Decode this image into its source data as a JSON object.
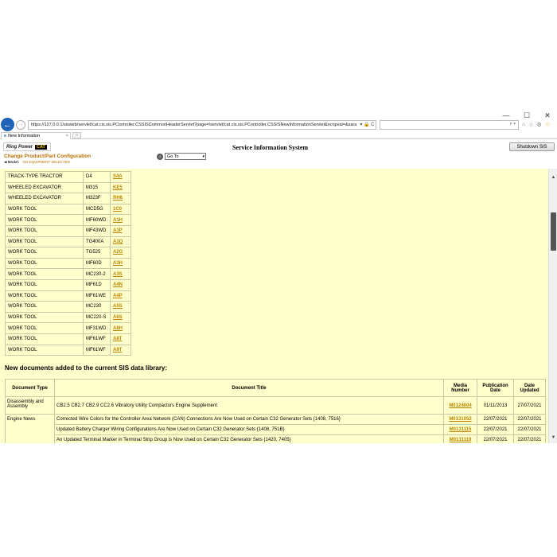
{
  "browser": {
    "window_controls": [
      "—",
      "☐",
      "✕"
    ],
    "url": "https://127.0.0.1/sisweb/servlet/cat.cis.sis.PController.CSSISCommonHeaderServlet?page=/servlet/cat.cis.sis.PController.CSSISNewInformationServlet&ncnpval=&sara",
    "url_security": "▾ 🔒 C",
    "search_text": "⌕ ▾",
    "tab_title": "New Information",
    "tab_icon": "e",
    "tab_close": "×",
    "toolbar_icons": [
      "⌂",
      "☆",
      "⚙",
      "☺"
    ]
  },
  "header": {
    "logo_ringpower": "Ring Power",
    "logo_cat": "CAT",
    "title": "Service Information System",
    "shutdown_label": "Shutdown SIS",
    "change_link": "Change Product/Part Configuration",
    "model_label": "Model:",
    "model_value": "NO EQUIPMENT SELECTED",
    "goto_value": "Go To",
    "goto_arrow": "▾"
  },
  "products": [
    {
      "family": "TRACK-TYPE TRACTOR",
      "model": "D4",
      "prefix": "S4A"
    },
    {
      "family": "WHEELED EXCAVATOR",
      "model": "M315",
      "prefix": "KE5"
    },
    {
      "family": "WHEELED EXCAVATOR",
      "model": "M323F",
      "prefix": "RH6"
    },
    {
      "family": "WORK TOOL",
      "model": "MCD5G",
      "prefix": "1C0"
    },
    {
      "family": "WORK TOOL",
      "model": "MF60WD",
      "prefix": "A1H"
    },
    {
      "family": "WORK TOOL",
      "model": "MF43WD",
      "prefix": "A1P"
    },
    {
      "family": "WORK TOOL",
      "model": "TG400A",
      "prefix": "A1Q"
    },
    {
      "family": "WORK TOOL",
      "model": "TG525",
      "prefix": "A2G"
    },
    {
      "family": "WORK TOOL",
      "model": "MF60D",
      "prefix": "A3H"
    },
    {
      "family": "WORK TOOL",
      "model": "MC230-2",
      "prefix": "A3S"
    },
    {
      "family": "WORK TOOL",
      "model": "MF61D",
      "prefix": "A4N"
    },
    {
      "family": "WORK TOOL",
      "model": "MF61WE",
      "prefix": "A4P"
    },
    {
      "family": "WORK TOOL",
      "model": "MC230",
      "prefix": "A5S"
    },
    {
      "family": "WORK TOOL",
      "model": "MC220-S",
      "prefix": "A6S"
    },
    {
      "family": "WORK TOOL",
      "model": "MF31WD",
      "prefix": "A8H"
    },
    {
      "family": "WORK TOOL",
      "model": "MF61WF",
      "prefix": "A8T"
    },
    {
      "family": "WORK TOOL",
      "model": "MF61WF",
      "prefix": "A9T"
    }
  ],
  "new_docs": {
    "heading": "New documents added to the current SIS data library:",
    "columns": {
      "type": "Document Type",
      "title": "Document Title",
      "media": "Media Number",
      "pub": "Publication Date",
      "updated": "Date Updated"
    },
    "rows": [
      {
        "type": "Disassembly and Assembly",
        "title": "CB2.5 CB2.7 CB2.9 CC2.6 Vibratory Utility Compactors Engine Supplement",
        "media": "M0124604",
        "pub": "01/11/2013",
        "updated": "27/07/2021"
      },
      {
        "type": "Engine News",
        "title": "Corrected Wire Colors for the Controller Area Network (CAN) Connections Are Now Used on Certain C32 Generator Sets {1408, 7516}",
        "media": "M0131052",
        "pub": "22/07/2021",
        "updated": "22/07/2021"
      },
      {
        "type": "",
        "title": "Updated Battery Charger Wiring Configurations Are Now Used on Certain C32 Generator Sets {1408, 751B}",
        "media": "M0131115",
        "pub": "22/07/2021",
        "updated": "22/07/2021"
      },
      {
        "type": "",
        "title": "An Updated Terminal Marker in Terminal Strip Group is Now Used on Certain C32 Generator Sets {1420, 7405}",
        "media": "M0131119",
        "pub": "22/07/2021",
        "updated": "22/07/2021"
      }
    ]
  },
  "scrollbar": {
    "up": "▲",
    "down": "▼"
  },
  "colors": {
    "content_bg": "#ffffcc",
    "link": "#b88600",
    "brand_orange": "#b86f00",
    "back_button": "#1e63b8"
  }
}
